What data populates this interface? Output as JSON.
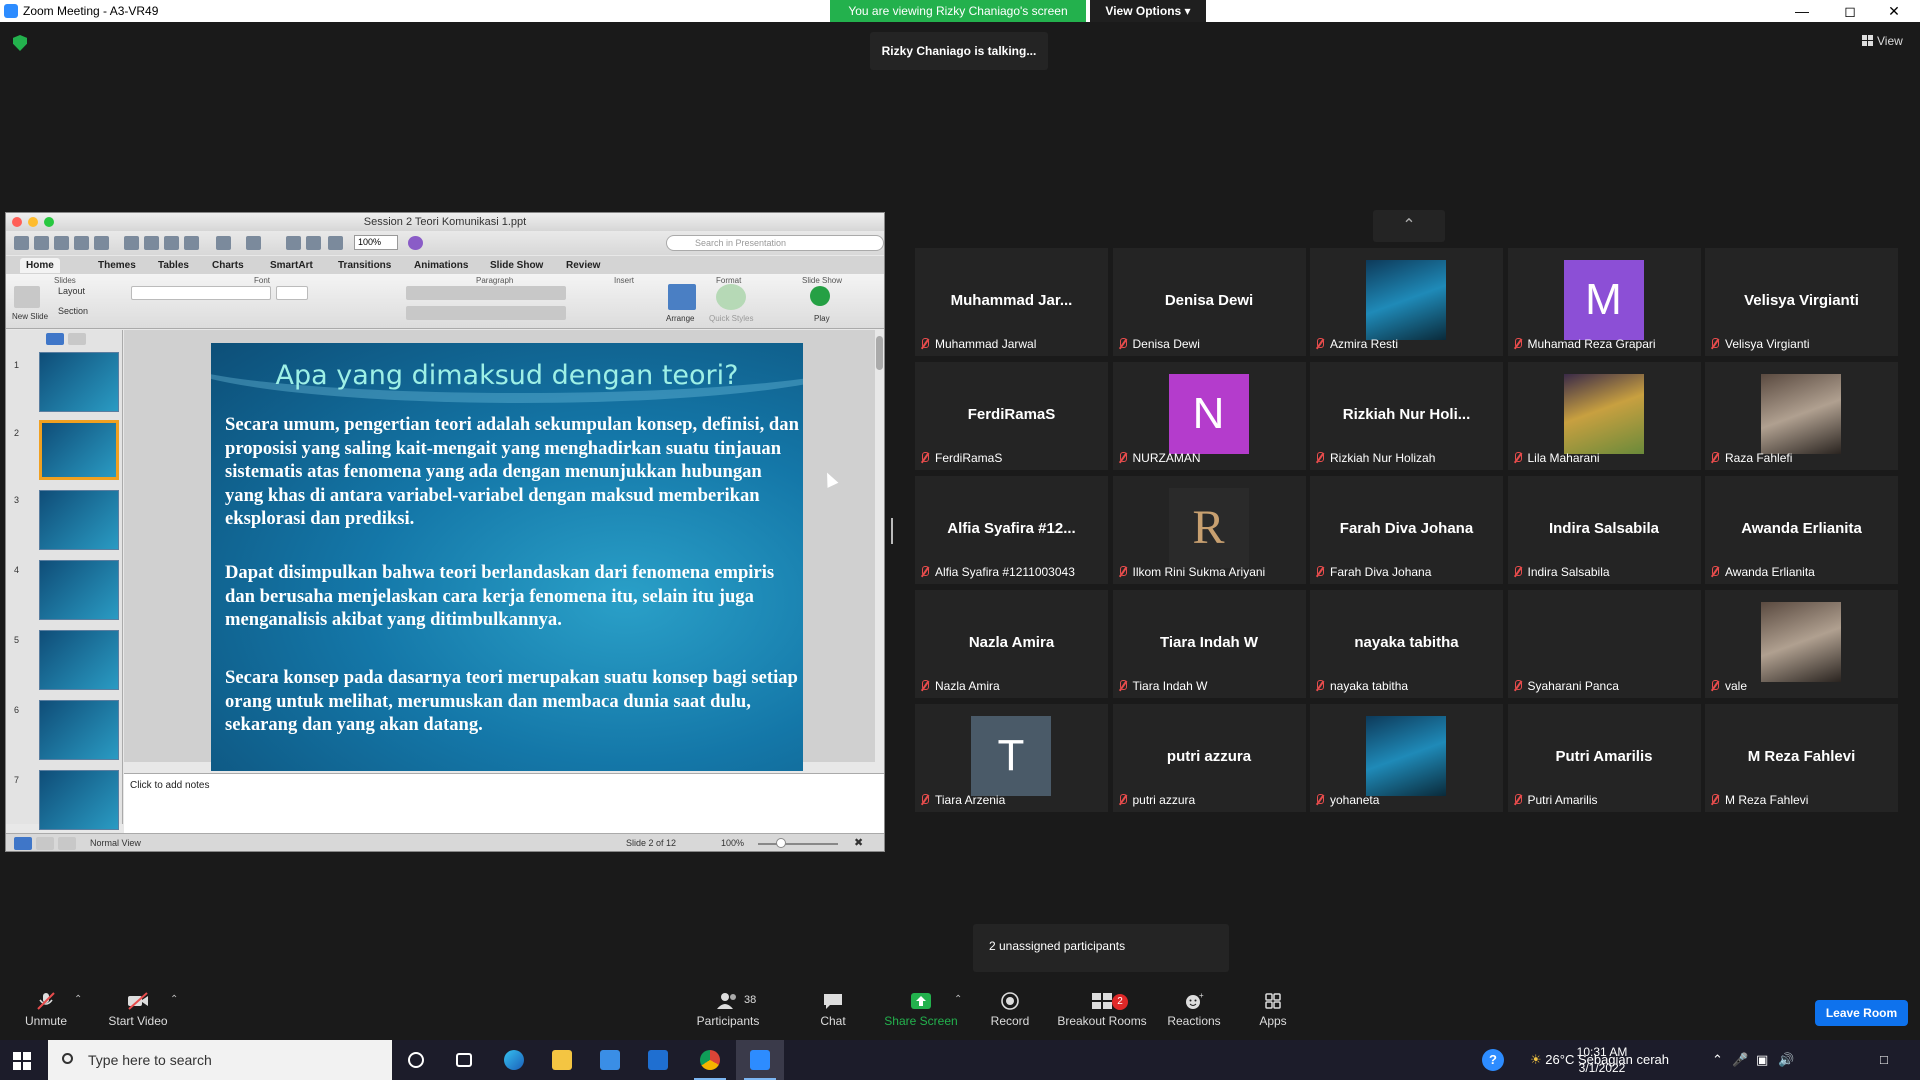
{
  "window": {
    "title": "Zoom Meeting - A3-VR49",
    "sharing_banner": "You are viewing Rizky Chaniago's screen",
    "view_options": "View Options",
    "talking_indicator": "Rizky Chaniago is talking...",
    "view_button": "View"
  },
  "shared_screen": {
    "file_title": "Session 2 Teori Komunikasi 1.ppt",
    "zoom_value": "100%",
    "search_placeholder": "Search in Presentation",
    "ribbon_tabs": [
      "Home",
      "Themes",
      "Tables",
      "Charts",
      "SmartArt",
      "Transitions",
      "Animations",
      "Slide Show",
      "Review"
    ],
    "ribbon_groups": [
      "Slides",
      "Font",
      "Paragraph",
      "Insert",
      "Format",
      "Slide Show"
    ],
    "ribbon_buttons": {
      "new_slide": "New Slide",
      "layout": "Layout",
      "section": "Section",
      "arrange": "Arrange",
      "quick_styles": "Quick Styles",
      "play": "Play"
    },
    "thumbnail_numbers": [
      "1",
      "2",
      "3",
      "4",
      "5",
      "6",
      "7"
    ],
    "selected_thumbnail": 2,
    "slide": {
      "title": "Apa yang dimaksud dengan teori?",
      "paragraphs": [
        "Secara umum, pengertian teori adalah sekumpulan konsep, definisi, dan proposisi yang saling kait-mengait yang menghadirkan suatu tinjauan sistematis atas fenomena yang ada dengan menunjukkan hubungan yang khas di antara variabel-variabel dengan maksud memberikan eksplorasi dan prediksi.",
        "Dapat disimpulkan bahwa teori berlandaskan dari fenomena empiris dan berusaha menjelaskan cara kerja fenomena itu, selain itu juga menganalisis akibat yang ditimbulkannya.",
        "Secara konsep pada dasarnya teori merupakan suatu konsep bagi setiap orang untuk melihat, merumuskan dan membaca dunia saat dulu, sekarang dan yang akan datang."
      ]
    },
    "notes_placeholder": "Click to add notes",
    "status": {
      "view": "Normal View",
      "slide_counter": "Slide 2 of 12",
      "zoom": "100%"
    }
  },
  "participants": [
    {
      "display": "Muhammad  Jar...",
      "name": "Muhammad Jarwal",
      "avatar": "name"
    },
    {
      "display": "Denisa Dewi",
      "name": "Denisa Dewi",
      "avatar": "name"
    },
    {
      "display": "",
      "name": "Azmira Resti",
      "avatar": "photo"
    },
    {
      "display": "M",
      "name": "Muhamad Reza Grapari",
      "avatar": "letter",
      "color": "#8c4fd6"
    },
    {
      "display": "Velisya Virgianti",
      "name": "Velisya Virgianti",
      "avatar": "name"
    },
    {
      "display": "FerdiRamaS",
      "name": "FerdiRamaS",
      "avatar": "name"
    },
    {
      "display": "N",
      "name": "NURZAMAN",
      "avatar": "letter",
      "color": "#b43ccc"
    },
    {
      "display": "Rizkiah  Nur  Holi...",
      "name": "Rizkiah Nur Holizah",
      "avatar": "name"
    },
    {
      "display": "",
      "name": "Lila Maharani",
      "avatar": "photo"
    },
    {
      "display": "",
      "name": "Raza Fahlefi",
      "avatar": "photo"
    },
    {
      "display": "Alfia Syafira #12...",
      "name": "Alfia Syafira #1211003043",
      "avatar": "name"
    },
    {
      "display": "",
      "name": "Ilkom Rini Sukma Ariyani",
      "avatar": "logo"
    },
    {
      "display": "Farah Diva Johana",
      "name": "Farah Diva Johana",
      "avatar": "name"
    },
    {
      "display": "Indira Salsabila",
      "name": "Indira Salsabila",
      "avatar": "name"
    },
    {
      "display": "Awanda Erlianita",
      "name": "Awanda Erlianita",
      "avatar": "name"
    },
    {
      "display": "Nazla Amira",
      "name": "Nazla Amira",
      "avatar": "name"
    },
    {
      "display": "Tiara Indah W",
      "name": "Tiara Indah W",
      "avatar": "name"
    },
    {
      "display": "nayaka tabitha",
      "name": "nayaka tabitha",
      "avatar": "name"
    },
    {
      "display": "",
      "name": "Syaharani Panca",
      "avatar": "blank"
    },
    {
      "display": "",
      "name": "vale",
      "avatar": "photo"
    },
    {
      "display": "T",
      "name": "Tiara Arzenia",
      "avatar": "letter",
      "color": "#4a5a68"
    },
    {
      "display": "putri azzura",
      "name": "putri azzura",
      "avatar": "name"
    },
    {
      "display": "",
      "name": "yohaneta",
      "avatar": "photo"
    },
    {
      "display": "Putri Amarilis",
      "name": "Putri Amarilis",
      "avatar": "name"
    },
    {
      "display": "M Reza Fahlevi",
      "name": "M Reza Fahlevi",
      "avatar": "name"
    }
  ],
  "unassigned_popup": "2 unassigned participants",
  "controls": {
    "unmute": "Unmute",
    "start_video": "Start Video",
    "participants": "Participants",
    "participants_count": "38",
    "chat": "Chat",
    "share_screen": "Share Screen",
    "record": "Record",
    "breakout_rooms": "Breakout Rooms",
    "breakout_badge": "2",
    "reactions": "Reactions",
    "apps": "Apps",
    "leave": "Leave Room"
  },
  "taskbar": {
    "search_placeholder": "Type here to search",
    "weather": "26°C  Sebagian cerah",
    "time": "10:31 AM",
    "date": "3/1/2022"
  },
  "colors": {
    "share_green": "#23b14d",
    "leave_blue": "#0e72ed",
    "muted_red": "#e74c4c",
    "tile_bg": "#242424"
  }
}
